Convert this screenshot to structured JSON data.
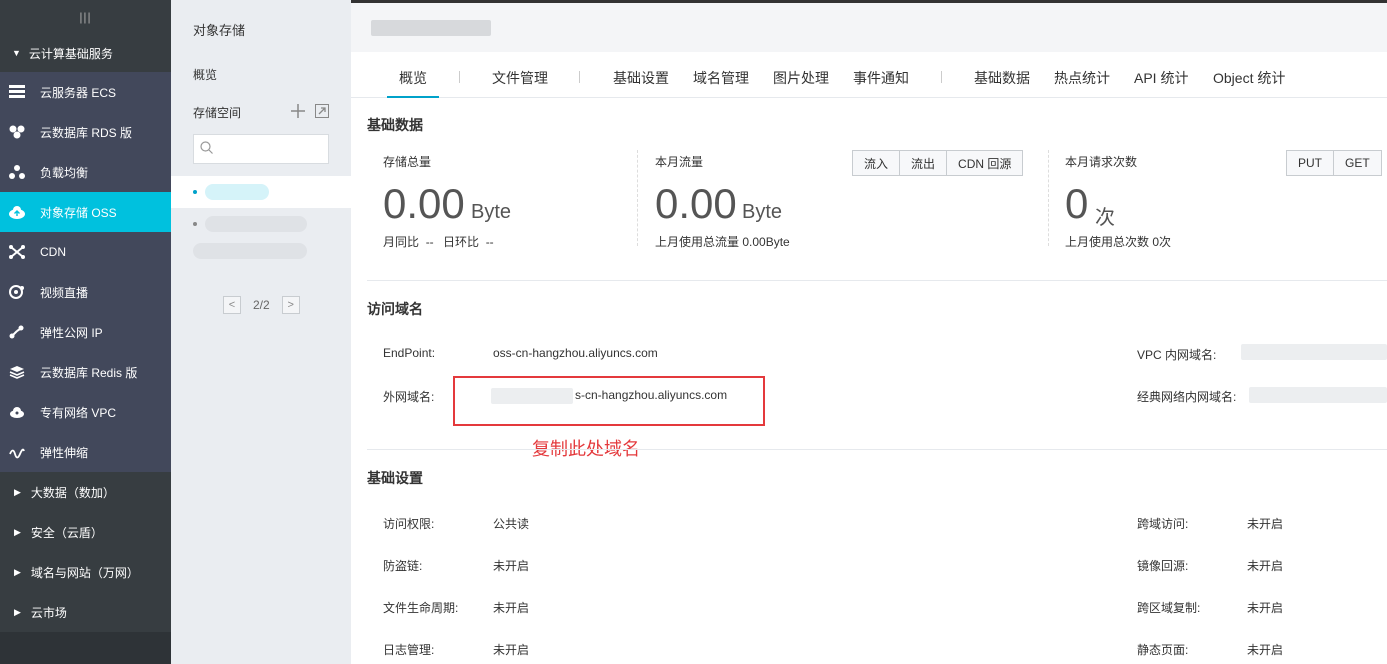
{
  "nav": {
    "menu_icon": "hamburger-icon",
    "group_label": "云计算基础服务",
    "items": [
      {
        "label": "云服务器 ECS",
        "icon": "server-icon"
      },
      {
        "label": "云数据库 RDS 版",
        "icon": "database-icon"
      },
      {
        "label": "负载均衡",
        "icon": "load-balancer-icon"
      },
      {
        "label": "对象存储 OSS",
        "icon": "cloud-storage-icon",
        "active": true
      },
      {
        "label": "CDN",
        "icon": "cdn-icon"
      },
      {
        "label": "视频直播",
        "icon": "live-video-icon"
      },
      {
        "label": "弹性公网 IP",
        "icon": "elastic-ip-icon"
      },
      {
        "label": "云数据库 Redis 版",
        "icon": "redis-icon"
      },
      {
        "label": "专有网络 VPC",
        "icon": "vpc-icon"
      },
      {
        "label": "弹性伸缩",
        "icon": "autoscaling-icon"
      }
    ],
    "collapsed": [
      "大数据（数加）",
      "安全（云盾）",
      "域名与网站（万网）",
      "云市场"
    ]
  },
  "subnav": {
    "title": "对象存储",
    "overview": "概览",
    "buckets_label": "存储空间",
    "search_placeholder": "",
    "pager": "2/2"
  },
  "tabs": [
    "概览",
    "文件管理",
    "基础设置",
    "域名管理",
    "图片处理",
    "事件通知",
    "基础数据",
    "热点统计",
    "API 统计",
    "Object 统计"
  ],
  "basic_data": {
    "title": "基础数据",
    "storage": {
      "label": "存储总量",
      "value": "0.00",
      "unit": "Byte",
      "mom_label": "月同比",
      "mom_value": "--",
      "dod_label": "日环比",
      "dod_value": "--"
    },
    "traffic": {
      "label": "本月流量",
      "value": "0.00",
      "unit": "Byte",
      "last_month": "上月使用总流量  0.00Byte",
      "buttons": [
        "流入",
        "流出",
        "CDN 回源"
      ]
    },
    "requests": {
      "label": "本月请求次数",
      "value": "0",
      "unit": "次",
      "last_month": "上月使用总次数  0次",
      "buttons": [
        "PUT",
        "GET"
      ]
    }
  },
  "domains": {
    "title": "访问域名",
    "endpoint_label": "EndPoint:",
    "endpoint_value": "oss-cn-hangzhou.aliyuncs.com",
    "external_label": "外网域名:",
    "external_value": "s-cn-hangzhou.aliyuncs.com",
    "vpc_label": "VPC 内网域名:",
    "classic_label": "经典网络内网域名:",
    "annotation": "复制此处域名"
  },
  "settings": {
    "title": "基础设置",
    "left": [
      {
        "label": "访问权限:",
        "value": "公共读"
      },
      {
        "label": "防盗链:",
        "value": "未开启"
      },
      {
        "label": "文件生命周期:",
        "value": "未开启"
      },
      {
        "label": "日志管理:",
        "value": "未开启"
      }
    ],
    "right": [
      {
        "label": "跨域访问:",
        "value": "未开启"
      },
      {
        "label": "镜像回源:",
        "value": "未开启"
      },
      {
        "label": "跨区域复制:",
        "value": "未开启"
      },
      {
        "label": "静态页面:",
        "value": "未开启"
      }
    ]
  },
  "colors": {
    "accent": "#00c1de",
    "annotation": "#e4393c",
    "nav_bg": "#373d41"
  }
}
